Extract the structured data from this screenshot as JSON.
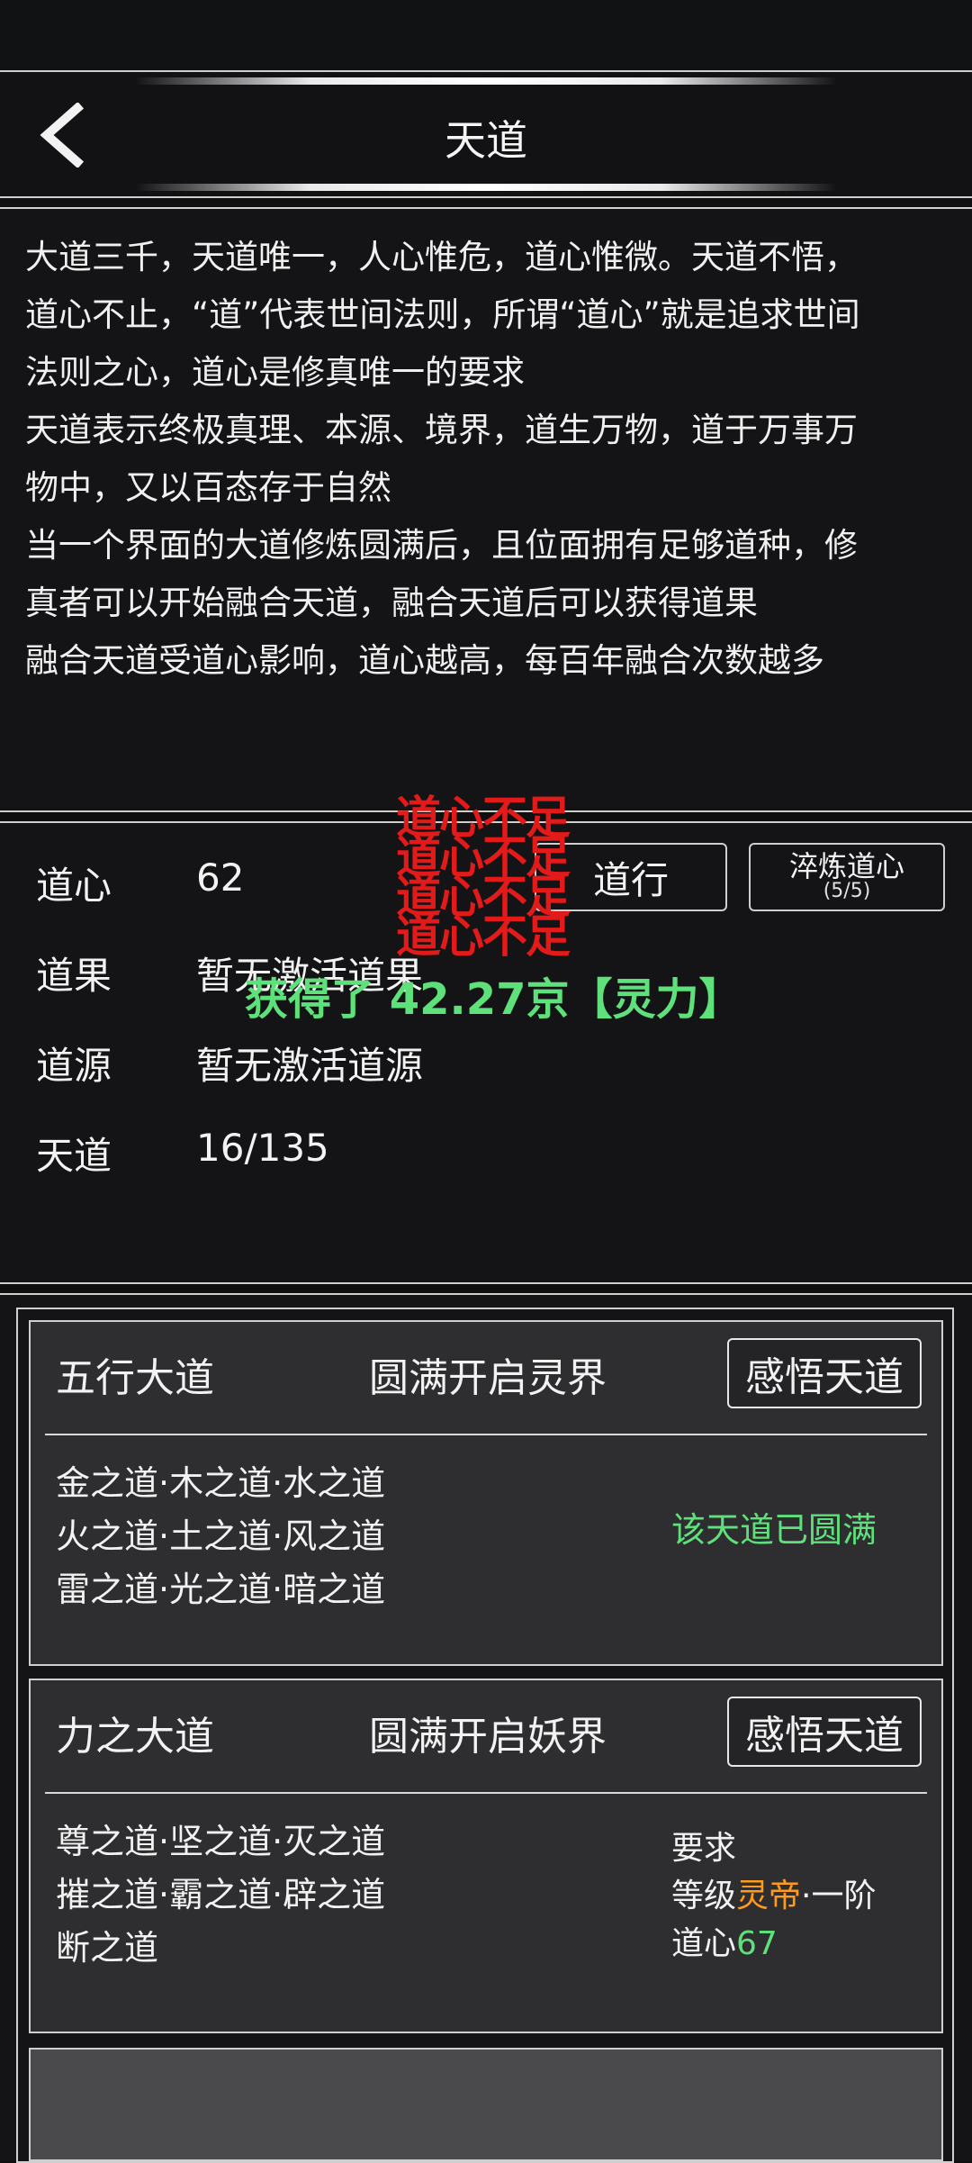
{
  "header": {
    "title": "天道"
  },
  "intro": {
    "lines": [
      "大道三千，天道唯一，人心惟危，道心惟微。天道不悟，\n道心不止，“道”代表世间法则，所谓“道心”就是追求世间\n法则之心，道心是修真唯一的要求",
      "天道表示终极真理、本源、境界，道生万物，道于万事万\n物中，又以百态存于自然",
      "当一个界面的大道修炼圆满后，且位面拥有足够道种，修\n真者可以开始融合天道，融合天道后可以获得道果",
      "融合天道受道心影响，道心越高，每百年融合次数越多"
    ]
  },
  "stats": {
    "daoxin": {
      "label": "道心",
      "value": "62"
    },
    "daoguo": {
      "label": "道果",
      "value": "暂无激活道果"
    },
    "daoyuan": {
      "label": "道源",
      "value": "暂无激活道源"
    },
    "tiandao": {
      "label": "天道",
      "value": "16/135"
    },
    "btn_daoxing": "道行",
    "btn_cuilian": "淬炼道心",
    "btn_cuilian_sub": "(5/5)"
  },
  "overlays": {
    "warnings": [
      "道心不足",
      "道心不足",
      "道心不足",
      "道心不足"
    ],
    "gain": "获得了 42.27京【灵力】"
  },
  "realms": [
    {
      "name": "五行大道",
      "unlock": "圆满开启灵界",
      "action": "感悟天道",
      "lines": [
        "金之道·木之道·水之道",
        "火之道·土之道·风之道",
        "雷之道·光之道·暗之道"
      ],
      "status": "该天道已圆满"
    },
    {
      "name": "力之大道",
      "unlock": "圆满开启妖界",
      "action": "感悟天道",
      "lines": [
        "尊之道·坚之道·灭之道",
        "摧之道·霸之道·辟之道",
        "断之道"
      ],
      "requirement": {
        "title": "要求",
        "level_prefix": "等级",
        "level_realm": "灵帝",
        "level_suffix": "·一阶",
        "daoxin_prefix": "道心",
        "daoxin_value": "67"
      }
    }
  ],
  "colors": {
    "accent_green": "#5ee07a",
    "warning_red": "#e21a1a",
    "orange": "#ff9a1a"
  }
}
